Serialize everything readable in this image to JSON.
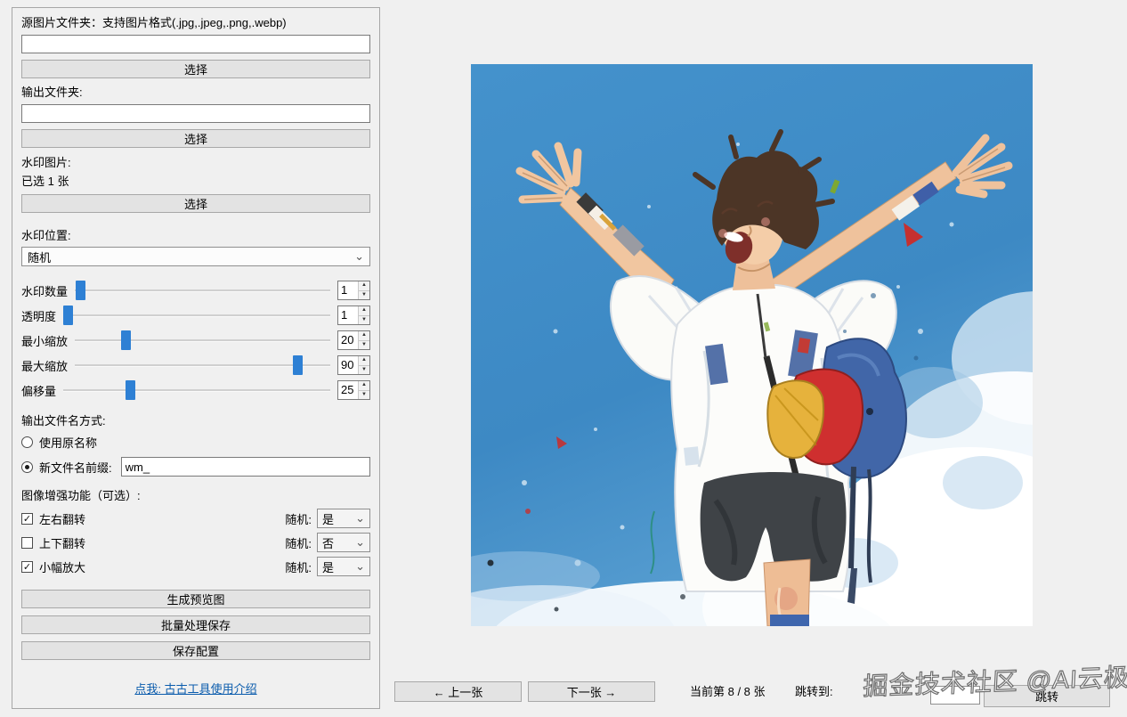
{
  "icons": {
    "chevron_down": "⌄",
    "spin_up": "▲",
    "spin_down": "▼"
  },
  "colors": {
    "slider_thumb": "#2e80d4",
    "link_blue": "#0b5cad",
    "sky_blue": "#3f8fc9"
  },
  "panel": {
    "source": {
      "label": "源图片文件夹：支持图片格式(.jpg,.jpeg,.png,.webp)",
      "value": "",
      "choose": "选择"
    },
    "output": {
      "label": "输出文件夹:",
      "value": "",
      "choose": "选择"
    },
    "watermark": {
      "label": "水印图片:",
      "count": "已选 1 张",
      "choose": "选择"
    },
    "position": {
      "label": "水印位置:",
      "value": "随机"
    },
    "sliders": [
      {
        "label": "水印数量",
        "value": "1",
        "percent": 2
      },
      {
        "label": "透明度",
        "value": "1",
        "percent": 0
      },
      {
        "label": "最小缩放",
        "value": "20",
        "percent": 20
      },
      {
        "label": "最大缩放",
        "value": "90",
        "percent": 87
      },
      {
        "label": "偏移量",
        "value": "25",
        "percent": 25
      }
    ],
    "naming": {
      "title": "输出文件名方式:",
      "options": [
        {
          "label": "使用原名称",
          "selected": false
        },
        {
          "label": "新文件名前缀:",
          "selected": true
        }
      ],
      "prefix_value": "wm_"
    },
    "enhance": {
      "title": "图像增强功能（可选）:",
      "rows": [
        {
          "label": "左右翻转",
          "checked": true,
          "mark": "✓",
          "random_label": "随机:",
          "random_value": "是"
        },
        {
          "label": "上下翻转",
          "checked": false,
          "mark": "",
          "random_label": "随机:",
          "random_value": "否"
        },
        {
          "label": "小幅放大",
          "checked": true,
          "mark": "✓",
          "random_label": "随机:",
          "random_value": "是"
        }
      ]
    },
    "actions": {
      "preview": "生成预览图",
      "batch": "批量处理保存",
      "save": "保存配置"
    },
    "help_link": "点我: 古古工具使用介绍"
  },
  "nav": {
    "prev": "← 上一张",
    "next": "下一张 →",
    "counter": "当前第 8 / 8 张",
    "jump_label": "跳转到:",
    "jump_value": "",
    "jump_button": "跳转"
  },
  "site_watermark": "掘金技术社区 @AI云极"
}
